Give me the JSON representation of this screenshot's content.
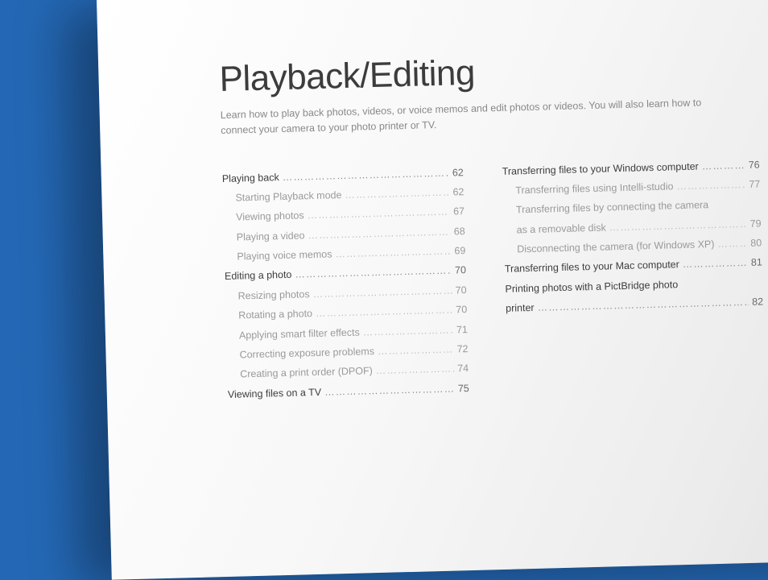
{
  "title": "Playback/Editing",
  "subtitle": "Learn how to play back photos, videos, or voice memos and edit photos or videos. You will also learn how to connect your camera to your photo printer or TV.",
  "leader": "………………………………………………………………………………",
  "col1": [
    {
      "type": "section",
      "label": "Playing back",
      "page": "62"
    },
    {
      "type": "sub",
      "label": "Starting Playback mode",
      "page": "62"
    },
    {
      "type": "sub",
      "label": "Viewing photos",
      "page": "67"
    },
    {
      "type": "sub",
      "label": "Playing a video",
      "page": "68"
    },
    {
      "type": "sub",
      "label": "Playing voice memos",
      "page": "69"
    },
    {
      "type": "section",
      "label": "Editing a photo",
      "page": "70"
    },
    {
      "type": "sub",
      "label": "Resizing photos",
      "page": "70"
    },
    {
      "type": "sub",
      "label": "Rotating a photo",
      "page": "70"
    },
    {
      "type": "sub",
      "label": "Applying smart filter effects",
      "page": "71"
    },
    {
      "type": "sub",
      "label": "Correcting exposure problems",
      "page": "72"
    },
    {
      "type": "sub",
      "label": "Creating a print order (DPOF)",
      "page": "74"
    },
    {
      "type": "section",
      "label": "Viewing files on a TV",
      "page": "75"
    }
  ],
  "col2": [
    {
      "type": "section",
      "label": "Transferring files to your Windows computer",
      "page": "76"
    },
    {
      "type": "sub",
      "label": "Transferring files using Intelli-studio",
      "page": "77"
    },
    {
      "type": "sub-wrap",
      "label1": "Transferring files by connecting the camera",
      "label2": "as a removable disk",
      "page": "79"
    },
    {
      "type": "sub",
      "label": "Disconnecting the camera (for Windows XP)",
      "page": "80"
    },
    {
      "type": "section",
      "label": "Transferring files to your Mac computer",
      "page": "81"
    },
    {
      "type": "section-wrap",
      "label1": "Printing photos with a PictBridge photo",
      "label2": "printer",
      "page": "82"
    }
  ]
}
